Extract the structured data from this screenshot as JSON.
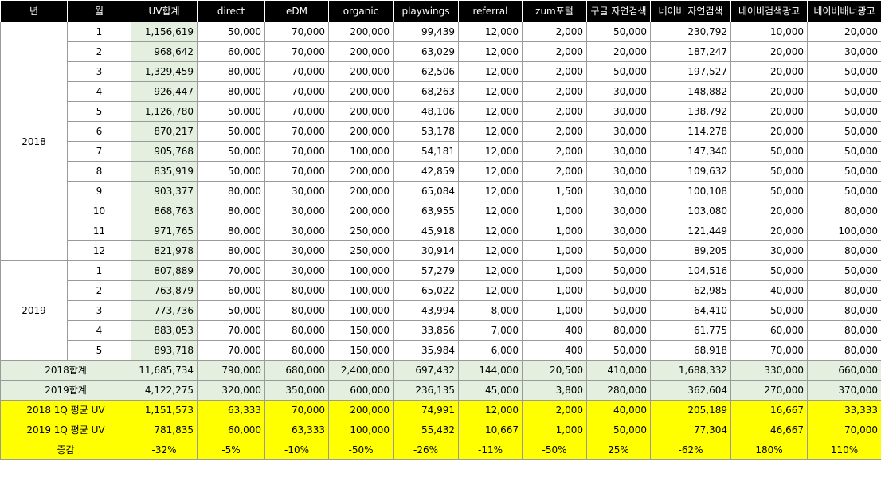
{
  "columns": [
    "년",
    "월",
    "UV합계",
    "direct",
    "eDM",
    "organic",
    "playwings",
    "referral",
    "zum포털",
    "구글 자연검색",
    "네이버 자연검색",
    "네이버검색광고",
    "네이버배너광고"
  ],
  "groups": [
    {
      "year": "2018",
      "rows": [
        [
          "1",
          "1,156,619",
          "50,000",
          "70,000",
          "200,000",
          "99,439",
          "12,000",
          "2,000",
          "50,000",
          "230,792",
          "10,000",
          "20,000"
        ],
        [
          "2",
          "968,642",
          "60,000",
          "70,000",
          "200,000",
          "63,029",
          "12,000",
          "2,000",
          "20,000",
          "187,247",
          "20,000",
          "30,000"
        ],
        [
          "3",
          "1,329,459",
          "80,000",
          "70,000",
          "200,000",
          "62,506",
          "12,000",
          "2,000",
          "50,000",
          "197,527",
          "20,000",
          "50,000"
        ],
        [
          "4",
          "926,447",
          "80,000",
          "70,000",
          "200,000",
          "68,263",
          "12,000",
          "2,000",
          "30,000",
          "148,882",
          "20,000",
          "50,000"
        ],
        [
          "5",
          "1,126,780",
          "50,000",
          "70,000",
          "200,000",
          "48,106",
          "12,000",
          "2,000",
          "30,000",
          "138,792",
          "20,000",
          "50,000"
        ],
        [
          "6",
          "870,217",
          "50,000",
          "70,000",
          "200,000",
          "53,178",
          "12,000",
          "2,000",
          "30,000",
          "114,278",
          "20,000",
          "50,000"
        ],
        [
          "7",
          "905,768",
          "50,000",
          "70,000",
          "100,000",
          "54,181",
          "12,000",
          "2,000",
          "30,000",
          "147,340",
          "50,000",
          "50,000"
        ],
        [
          "8",
          "835,919",
          "50,000",
          "70,000",
          "200,000",
          "42,859",
          "12,000",
          "2,000",
          "30,000",
          "109,632",
          "50,000",
          "50,000"
        ],
        [
          "9",
          "903,377",
          "80,000",
          "30,000",
          "200,000",
          "65,084",
          "12,000",
          "1,500",
          "30,000",
          "100,108",
          "50,000",
          "50,000"
        ],
        [
          "10",
          "868,763",
          "80,000",
          "30,000",
          "200,000",
          "63,955",
          "12,000",
          "1,000",
          "30,000",
          "103,080",
          "20,000",
          "80,000"
        ],
        [
          "11",
          "971,765",
          "80,000",
          "30,000",
          "250,000",
          "45,918",
          "12,000",
          "1,000",
          "30,000",
          "121,449",
          "20,000",
          "100,000"
        ],
        [
          "12",
          "821,978",
          "80,000",
          "30,000",
          "250,000",
          "30,914",
          "12,000",
          "1,000",
          "50,000",
          "89,205",
          "30,000",
          "80,000"
        ]
      ]
    },
    {
      "year": "2019",
      "rows": [
        [
          "1",
          "807,889",
          "70,000",
          "30,000",
          "100,000",
          "57,279",
          "12,000",
          "1,000",
          "50,000",
          "104,516",
          "50,000",
          "50,000"
        ],
        [
          "2",
          "763,879",
          "60,000",
          "80,000",
          "100,000",
          "65,022",
          "12,000",
          "1,000",
          "50,000",
          "62,985",
          "40,000",
          "80,000"
        ],
        [
          "3",
          "773,736",
          "50,000",
          "80,000",
          "100,000",
          "43,994",
          "8,000",
          "1,000",
          "50,000",
          "64,410",
          "50,000",
          "80,000"
        ],
        [
          "4",
          "883,053",
          "70,000",
          "80,000",
          "150,000",
          "33,856",
          "7,000",
          "400",
          "80,000",
          "61,775",
          "60,000",
          "80,000"
        ],
        [
          "5",
          "893,718",
          "70,000",
          "80,000",
          "150,000",
          "35,984",
          "6,000",
          "400",
          "50,000",
          "68,918",
          "70,000",
          "80,000"
        ]
      ]
    }
  ],
  "totals": [
    {
      "label": "2018합계",
      "values": [
        "11,685,734",
        "790,000",
        "680,000",
        "2,400,000",
        "697,432",
        "144,000",
        "20,500",
        "410,000",
        "1,688,332",
        "330,000",
        "660,000"
      ]
    },
    {
      "label": "2019합계",
      "values": [
        "4,122,275",
        "320,000",
        "350,000",
        "600,000",
        "236,135",
        "45,000",
        "3,800",
        "280,000",
        "362,604",
        "270,000",
        "370,000"
      ]
    }
  ],
  "summary": [
    {
      "label": "2018 1Q 평균 UV",
      "values": [
        "1,151,573",
        "63,333",
        "70,000",
        "200,000",
        "74,991",
        "12,000",
        "2,000",
        "40,000",
        "205,189",
        "16,667",
        "33,333"
      ]
    },
    {
      "label": "2019 1Q 평균 UV",
      "values": [
        "781,835",
        "60,000",
        "63,333",
        "100,000",
        "55,432",
        "10,667",
        "1,000",
        "50,000",
        "77,304",
        "46,667",
        "70,000"
      ]
    },
    {
      "label": "증감",
      "values": [
        "-32%",
        "-5%",
        "-10%",
        "-50%",
        "-26%",
        "-11%",
        "-50%",
        "25%",
        "-62%",
        "180%",
        "110%"
      ]
    }
  ],
  "colors": {
    "header_bg": "#000000",
    "uv_bg": "#e5efe0",
    "highlight": "#ffff00"
  }
}
